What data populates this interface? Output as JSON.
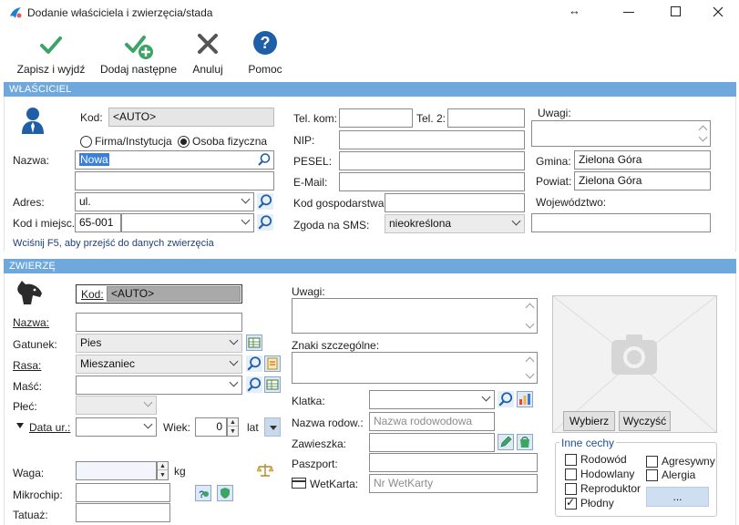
{
  "window": {
    "title": "Dodanie właściciela i zwierzęcia/stada"
  },
  "toolbar": {
    "save_exit": "Zapisz i wyjdź",
    "add_next": "Dodaj następne",
    "cancel": "Anuluj",
    "help": "Pomoc"
  },
  "owner": {
    "section_title": "WŁAŚCICIEL",
    "kod_label": "Kod:",
    "kod_value": "<AUTO>",
    "radio_firm": "Firma/Instytucja",
    "radio_person": "Osoba fizyczna",
    "name_label": "Nazwa:",
    "name_value": "Nowa",
    "address_label": "Adres:",
    "address_value": "ul.",
    "zip_label": "Kod i miejsc.:",
    "zip_value": "65-001",
    "hint": "Wciśnij F5, aby przejść do danych zwierzęcia",
    "tel_kom_label": "Tel. kom:",
    "tel2_label": "Tel. 2:",
    "nip_label": "NIP:",
    "pesel_label": "PESEL:",
    "email_label": "E-Mail:",
    "farm_code_label": "Kod gospodarstwa",
    "sms_label": "Zgoda na SMS:",
    "sms_value": "nieokreślona",
    "notes_label": "Uwagi:",
    "gmina_label": "Gmina:",
    "gmina_value": "Zielona Góra",
    "powiat_label": "Powiat:",
    "powiat_value": "Zielona Góra",
    "woj_label": "Województwo:"
  },
  "animal": {
    "section_title": "ZWIERZĘ",
    "kod_label": "Kod:",
    "kod_value": "<AUTO>",
    "name_label": "Nazwa:",
    "species_label": "Gatunek:",
    "species_value": "Pies",
    "breed_label": "Rasa:",
    "breed_value": "Mieszaniec",
    "color_label": "Maść:",
    "sex_label": "Płeć:",
    "birth_label": "Data ur.:",
    "age_label": "Wiek:",
    "age_value": "0",
    "age_unit": "lat",
    "weight_label": "Waga:",
    "weight_unit": "kg",
    "microchip_label": "Mikrochip:",
    "tattoo_label": "Tatuaż:",
    "notes_label": "Uwagi:",
    "marks_label": "Znaki szczególne:",
    "cage_label": "Klatka:",
    "pedigree_label": "Nazwa rodow.:",
    "pedigree_placeholder": "Nazwa rodowodowa",
    "tag_label": "Zawieszka:",
    "passport_label": "Paszport:",
    "wetkarta_label": "WetKarta:",
    "wetkarta_placeholder": "Nr WetKarty",
    "photo_choose": "Wybierz",
    "photo_clear": "Wyczyść",
    "other_traits_title": "Inne cechy",
    "traits": [
      {
        "label": "Rodowód",
        "checked": false
      },
      {
        "label": "Hodowlany",
        "checked": false
      },
      {
        "label": "Reproduktor",
        "checked": false
      },
      {
        "label": "Płodny",
        "checked": true
      },
      {
        "label": "Agresywny",
        "checked": false
      },
      {
        "label": "Alergia",
        "checked": false
      }
    ],
    "more_button": "..."
  },
  "colors": {
    "section_bar": "#6fa8dc",
    "accent_green": "#3aa564",
    "help_blue": "#1f5fa8"
  }
}
